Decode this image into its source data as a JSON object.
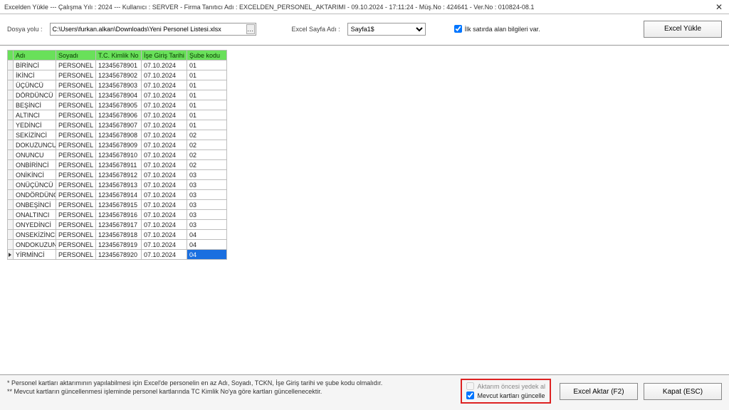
{
  "title": "Excelden Yükle  ---  Çalışma Yılı : 2024  ---  Kullanıcı : SERVER - Firma Tanıtıcı Adı : EXCELDEN_PERSONEL_AKTARIMI - 09.10.2024 - 17:11:24 - Müş.No : 424641 - Ver.No : 010824-08.1",
  "topbar": {
    "path_label": "Dosya yolu :",
    "path_value": "C:\\Users\\furkan.alkan\\Downloads\\Yeni Personel Listesi.xlsx",
    "sheet_label": "Excel Sayfa Adı :",
    "sheet_value": "Sayfa1$",
    "first_row_label": "İlk satırda alan bilgileri var.",
    "load_btn": "Excel Yükle"
  },
  "columns": {
    "adi": "Adı",
    "soyadi": "Soyadı",
    "tckn": "T.C. Kimlik No",
    "ise_giris": "İşe Giriş Tarihi",
    "sube": "Şube kodu"
  },
  "rows": [
    {
      "adi": "BİRİNCİ",
      "soyadi": "PERSONEL",
      "tckn": "12345678901",
      "tarih": "07.10.2024",
      "sube": "01"
    },
    {
      "adi": "İKİNCİ",
      "soyadi": "PERSONEL",
      "tckn": "12345678902",
      "tarih": "07.10.2024",
      "sube": "01"
    },
    {
      "adi": "ÜÇÜNCÜ",
      "soyadi": "PERSONEL",
      "tckn": "12345678903",
      "tarih": "07.10.2024",
      "sube": "01"
    },
    {
      "adi": "DÖRDÜNCÜ",
      "soyadi": "PERSONEL",
      "tckn": "12345678904",
      "tarih": "07.10.2024",
      "sube": "01"
    },
    {
      "adi": "BEŞİNCİ",
      "soyadi": "PERSONEL",
      "tckn": "12345678905",
      "tarih": "07.10.2024",
      "sube": "01"
    },
    {
      "adi": "ALTINCI",
      "soyadi": "PERSONEL",
      "tckn": "12345678906",
      "tarih": "07.10.2024",
      "sube": "01"
    },
    {
      "adi": "YEDİNCİ",
      "soyadi": "PERSONEL",
      "tckn": "12345678907",
      "tarih": "07.10.2024",
      "sube": "01"
    },
    {
      "adi": "SEKİZİNCİ",
      "soyadi": "PERSONEL",
      "tckn": "12345678908",
      "tarih": "07.10.2024",
      "sube": "02"
    },
    {
      "adi": "DOKUZUNCU",
      "soyadi": "PERSONEL",
      "tckn": "12345678909",
      "tarih": "07.10.2024",
      "sube": "02"
    },
    {
      "adi": "ONUNCU",
      "soyadi": "PERSONEL",
      "tckn": "12345678910",
      "tarih": "07.10.2024",
      "sube": "02"
    },
    {
      "adi": "ONBİRİNCİ",
      "soyadi": "PERSONEL",
      "tckn": "12345678911",
      "tarih": "07.10.2024",
      "sube": "02"
    },
    {
      "adi": "ONİKİNCİ",
      "soyadi": "PERSONEL",
      "tckn": "12345678912",
      "tarih": "07.10.2024",
      "sube": "03"
    },
    {
      "adi": "ONÜÇÜNCÜ",
      "soyadi": "PERSONEL",
      "tckn": "12345678913",
      "tarih": "07.10.2024",
      "sube": "03"
    },
    {
      "adi": "ONDÖRDÜNCÜ",
      "soyadi": "PERSONEL",
      "tckn": "12345678914",
      "tarih": "07.10.2024",
      "sube": "03"
    },
    {
      "adi": "ONBEŞİNCİ",
      "soyadi": "PERSONEL",
      "tckn": "12345678915",
      "tarih": "07.10.2024",
      "sube": "03"
    },
    {
      "adi": "ONALTINCI",
      "soyadi": "PERSONEL",
      "tckn": "12345678916",
      "tarih": "07.10.2024",
      "sube": "03"
    },
    {
      "adi": "ONYEDİNCİ",
      "soyadi": "PERSONEL",
      "tckn": "12345678917",
      "tarih": "07.10.2024",
      "sube": "03"
    },
    {
      "adi": "ONSEKİZİNCİ",
      "soyadi": "PERSONEL",
      "tckn": "12345678918",
      "tarih": "07.10.2024",
      "sube": "04"
    },
    {
      "adi": "ONDOKUZUNCU",
      "soyadi": "PERSONEL",
      "tckn": "12345678919",
      "tarih": "07.10.2024",
      "sube": "04"
    },
    {
      "adi": "YİRMİNCİ",
      "soyadi": "PERSONEL",
      "tckn": "12345678920",
      "tarih": "07.10.2024",
      "sube": "04"
    }
  ],
  "selected_row": 19,
  "footer": {
    "hint1": "* Personel kartları aktarımının yapılabilmesi için Excel'de personelin en az Adı, Soyadı, TCKN, İşe Giriş tarihi ve şube kodu olmalıdır.",
    "hint2": "** Mevcut kartların güncellenmesi işleminde personel kartlarında TC Kimlik No'ya göre kartları güncellenecektir.",
    "backup_label": "Aktarım öncesi yedek al",
    "update_label": "Mevcut kartları güncelle",
    "transfer_btn": "Excel Aktar (F2)",
    "close_btn": "Kapat (ESC)"
  }
}
